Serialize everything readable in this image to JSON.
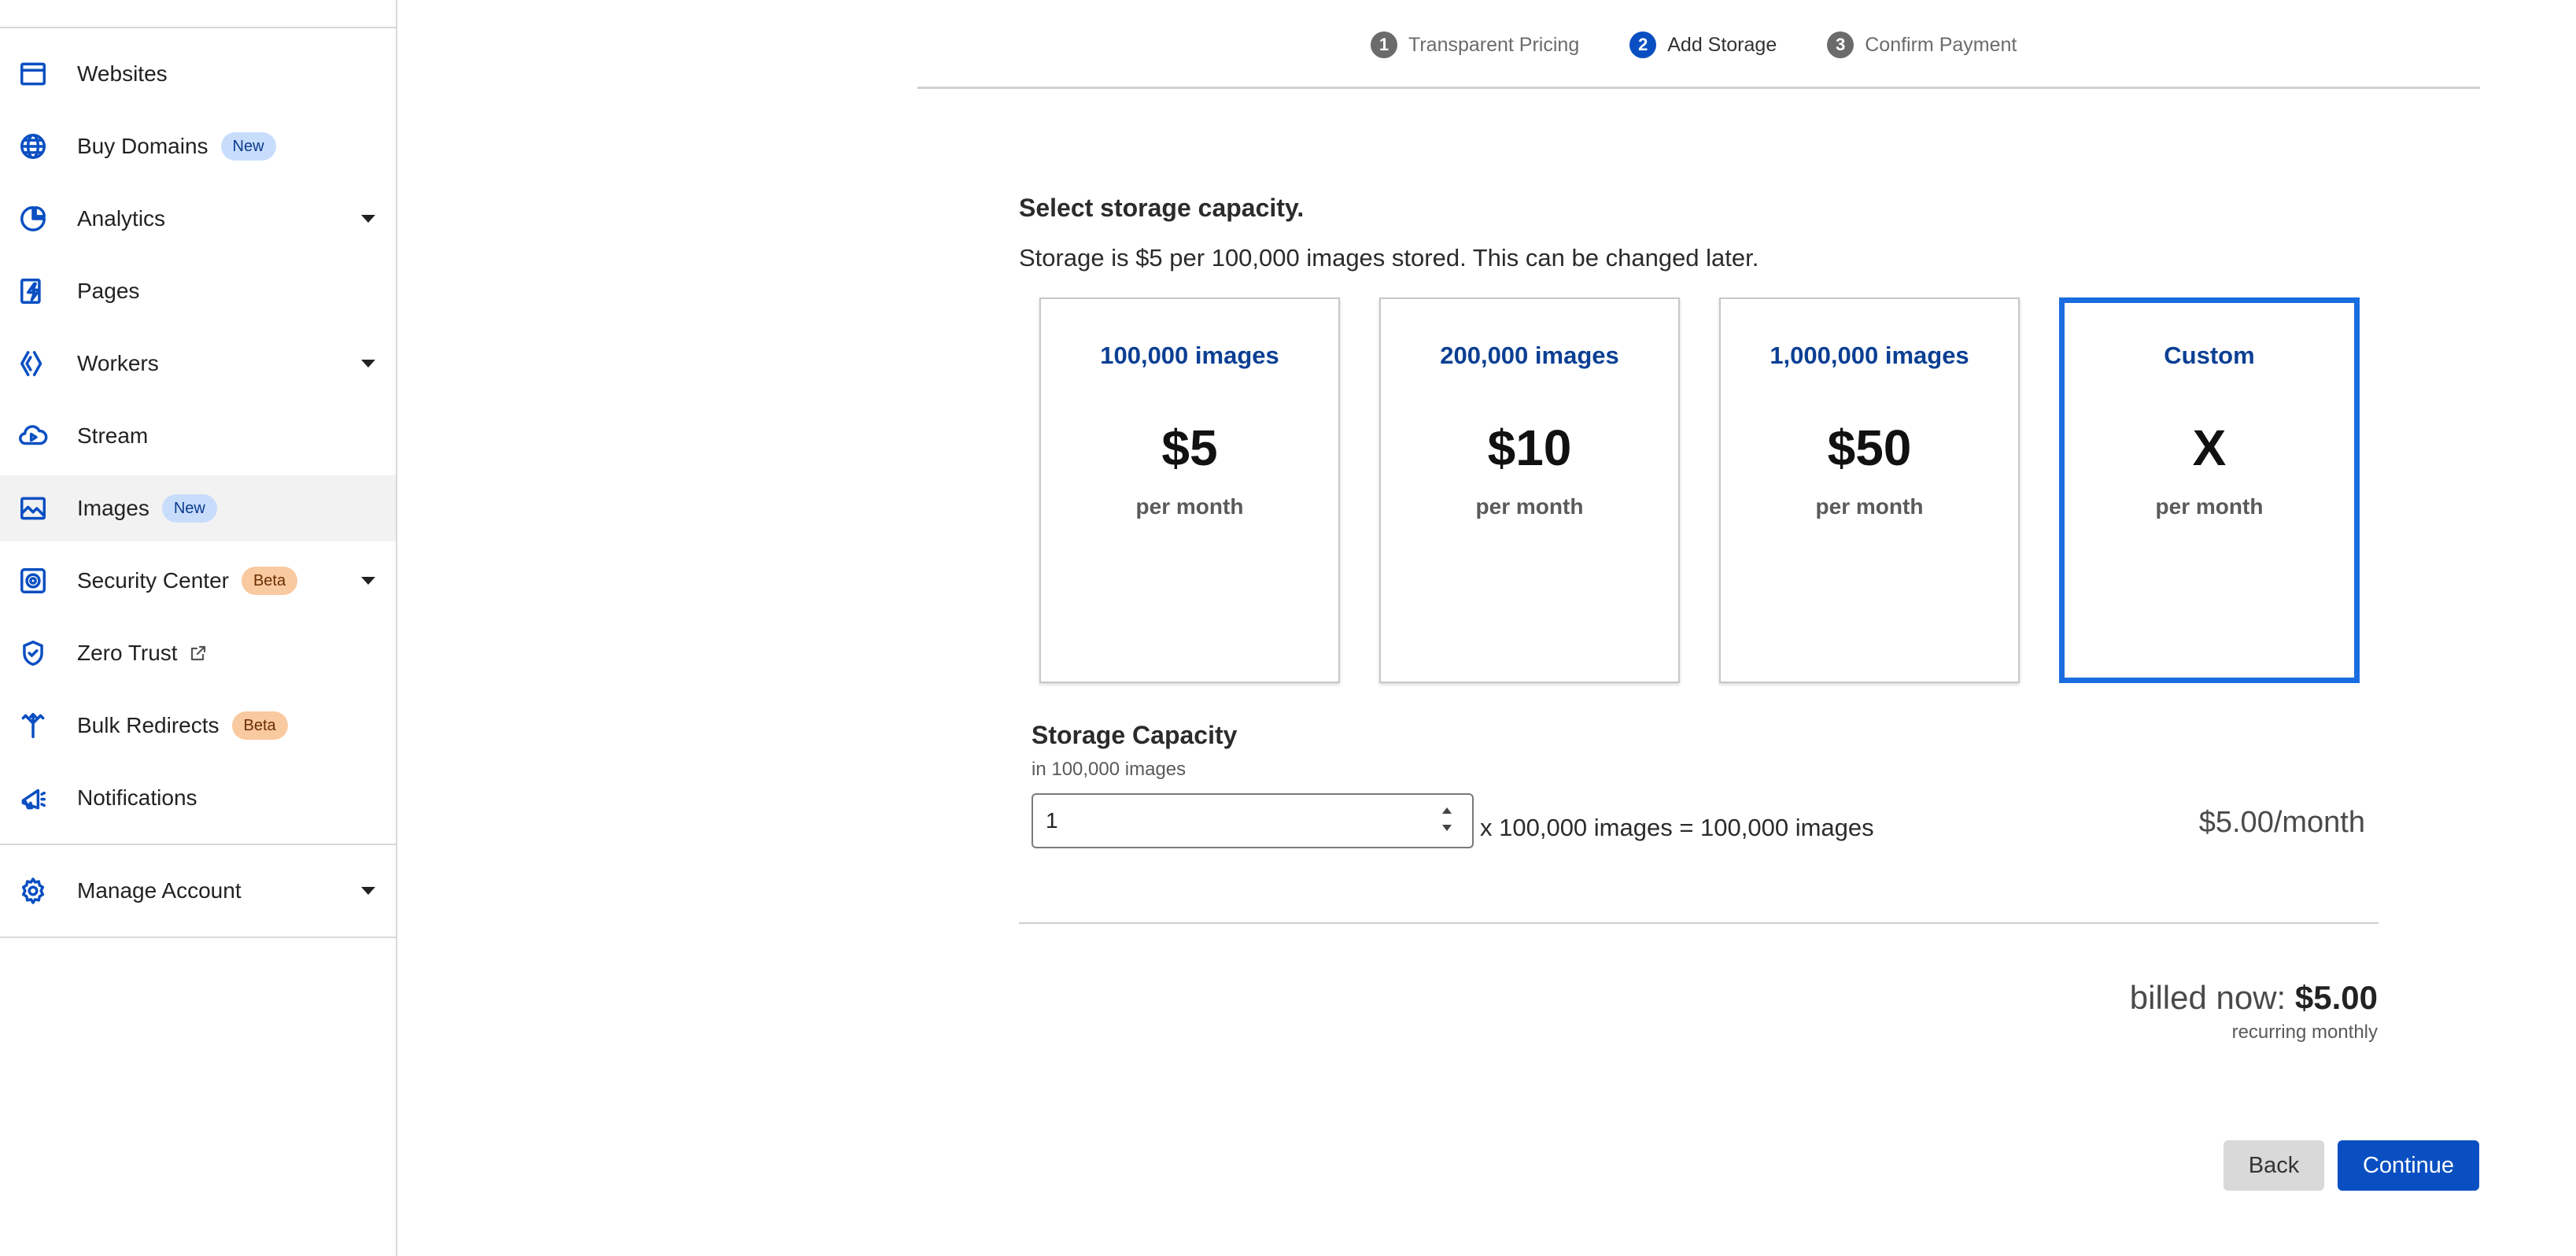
{
  "sidebar": {
    "items": [
      {
        "label": "Websites",
        "icon": "browser-window-icon"
      },
      {
        "label": "Buy Domains",
        "icon": "globe-icon",
        "badge": "New"
      },
      {
        "label": "Analytics",
        "icon": "pie-chart-icon"
      },
      {
        "label": "Pages",
        "icon": "lightning-icon"
      },
      {
        "label": "Workers",
        "icon": "workers-icon"
      },
      {
        "label": "Stream",
        "icon": "cloud-play-icon"
      },
      {
        "label": "Images",
        "icon": "image-icon",
        "badge": "New"
      },
      {
        "label": "Security Center",
        "icon": "shield-target-icon",
        "badge": "Beta"
      },
      {
        "label": "Zero Trust",
        "icon": "shield-icon"
      },
      {
        "label": "Bulk Redirects",
        "icon": "redirect-icon",
        "badge": "Beta"
      },
      {
        "label": "Notifications",
        "icon": "megaphone-icon"
      }
    ],
    "account": {
      "label": "Manage Account",
      "icon": "gear-icon"
    }
  },
  "stepper": {
    "steps": [
      {
        "num": "1",
        "label": "Transparent Pricing"
      },
      {
        "num": "2",
        "label": "Add Storage"
      },
      {
        "num": "3",
        "label": "Confirm Payment"
      }
    ],
    "current": "Add Storage"
  },
  "main": {
    "heading": "Select storage capacity.",
    "subtext": "Storage is $5 per 100,000 images stored. This can be changed later.",
    "cards": [
      {
        "title": "100,000 images",
        "price": "$5",
        "unit": "per month"
      },
      {
        "title": "200,000 images",
        "price": "$10",
        "unit": "per month"
      },
      {
        "title": "1,000,000 images",
        "price": "$50",
        "unit": "per month"
      },
      {
        "title": "Custom",
        "price": "X",
        "unit": "per month"
      }
    ],
    "selected_card": "Custom",
    "capacity": {
      "label": "Storage Capacity",
      "sublabel": "in 100,000 images",
      "value": "1",
      "calc": "x 100,000 images = 100,000 images",
      "price": "$5.00/month"
    },
    "billing": {
      "prefix": "billed now:",
      "amount": "$5.00",
      "note": "recurring monthly"
    },
    "buttons": {
      "back": "Back",
      "continue": "Continue"
    }
  },
  "colors": {
    "accent": "#0a4fc2",
    "selected_border": "#1a6de0",
    "card_title": "#0b3f93",
    "badge_new": "#c8ddfb",
    "badge_beta": "#f9c9a0"
  }
}
